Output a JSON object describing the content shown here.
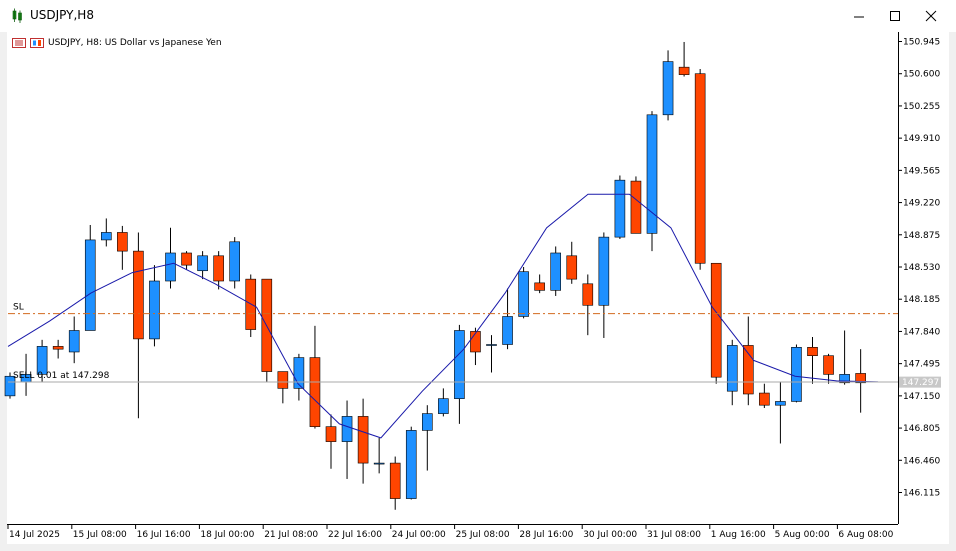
{
  "window": {
    "title": "USDJPY,H8"
  },
  "chart_header": {
    "text": "USDJPY, H8:  US Dollar vs Japanese Yen"
  },
  "colors": {
    "bull": "#1e90ff",
    "bear": "#ff4500",
    "ma": "#1a1aaa",
    "sl": "#d2691e"
  },
  "chart_data": {
    "type": "candlestick",
    "symbol": "USDJPY",
    "timeframe": "H8",
    "ylim": [
      145.815,
      151.12
    ],
    "y_ticks": [
      "150.945",
      "150.600",
      "150.255",
      "149.910",
      "149.565",
      "149.220",
      "148.875",
      "148.530",
      "148.185",
      "147.840",
      "147.495",
      "147.150",
      "146.805",
      "146.460",
      "146.115"
    ],
    "x_tick_labels": [
      "14 Jul 2025",
      "15 Jul 08:00",
      "16 Jul 16:00",
      "18 Jul 00:00",
      "21 Jul 08:00",
      "22 Jul 16:00",
      "24 Jul 00:00",
      "25 Jul 08:00",
      "28 Jul 16:00",
      "30 Jul 00:00",
      "31 Jul 08:00",
      "1 Aug 16:00",
      "5 Aug 00:00",
      "6 Aug 08:00"
    ],
    "current_price": "147.297",
    "sl_label": "SL",
    "sl_level": 148.03,
    "position_label": "SELL 0.01 at 147.298",
    "position_level": 147.298,
    "candles": [
      {
        "o": 147.15,
        "h": 147.4,
        "l": 147.12,
        "c": 147.36
      },
      {
        "o": 147.3,
        "h": 147.6,
        "l": 147.15,
        "c": 147.38
      },
      {
        "o": 147.38,
        "h": 147.75,
        "l": 147.3,
        "c": 147.68
      },
      {
        "o": 147.68,
        "h": 147.75,
        "l": 147.55,
        "c": 147.65
      },
      {
        "o": 147.62,
        "h": 148.0,
        "l": 147.5,
        "c": 147.85
      },
      {
        "o": 147.85,
        "h": 148.98,
        "l": 147.85,
        "c": 148.82
      },
      {
        "o": 148.82,
        "h": 149.05,
        "l": 148.75,
        "c": 148.9
      },
      {
        "o": 148.9,
        "h": 148.97,
        "l": 148.5,
        "c": 148.7
      },
      {
        "o": 148.7,
        "h": 148.9,
        "l": 146.91,
        "c": 147.76
      },
      {
        "o": 147.76,
        "h": 148.55,
        "l": 147.68,
        "c": 148.38
      },
      {
        "o": 148.38,
        "h": 148.95,
        "l": 148.3,
        "c": 148.68
      },
      {
        "o": 148.68,
        "h": 148.7,
        "l": 148.5,
        "c": 148.55
      },
      {
        "o": 148.49,
        "h": 148.7,
        "l": 148.4,
        "c": 148.65
      },
      {
        "o": 148.65,
        "h": 148.7,
        "l": 148.29,
        "c": 148.38
      },
      {
        "o": 148.38,
        "h": 148.85,
        "l": 148.3,
        "c": 148.8
      },
      {
        "o": 148.4,
        "h": 148.45,
        "l": 147.78,
        "c": 147.86
      },
      {
        "o": 148.4,
        "h": 148.4,
        "l": 147.3,
        "c": 147.41
      },
      {
        "o": 147.41,
        "h": 147.41,
        "l": 147.07,
        "c": 147.23
      },
      {
        "o": 147.23,
        "h": 147.6,
        "l": 147.1,
        "c": 147.56
      },
      {
        "o": 147.56,
        "h": 147.9,
        "l": 146.8,
        "c": 146.82
      },
      {
        "o": 146.82,
        "h": 146.95,
        "l": 146.37,
        "c": 146.66
      },
      {
        "o": 146.66,
        "h": 147.1,
        "l": 146.26,
        "c": 146.93
      },
      {
        "o": 146.93,
        "h": 147.12,
        "l": 146.21,
        "c": 146.43
      },
      {
        "o": 146.43,
        "h": 146.7,
        "l": 146.32,
        "c": 146.43
      },
      {
        "o": 146.43,
        "h": 146.5,
        "l": 145.93,
        "c": 146.05
      },
      {
        "o": 146.05,
        "h": 146.82,
        "l": 146.04,
        "c": 146.78
      },
      {
        "o": 146.78,
        "h": 147.05,
        "l": 146.35,
        "c": 146.96
      },
      {
        "o": 146.96,
        "h": 147.23,
        "l": 146.93,
        "c": 147.12
      },
      {
        "o": 147.12,
        "h": 147.91,
        "l": 146.85,
        "c": 147.85
      },
      {
        "o": 147.84,
        "h": 147.88,
        "l": 147.48,
        "c": 147.62
      },
      {
        "o": 147.7,
        "h": 147.8,
        "l": 147.4,
        "c": 147.7
      },
      {
        "o": 147.7,
        "h": 148.3,
        "l": 147.65,
        "c": 148.0
      },
      {
        "o": 148.0,
        "h": 148.53,
        "l": 147.98,
        "c": 148.48
      },
      {
        "o": 148.36,
        "h": 148.45,
        "l": 148.25,
        "c": 148.28
      },
      {
        "o": 148.28,
        "h": 148.75,
        "l": 148.22,
        "c": 148.68
      },
      {
        "o": 148.65,
        "h": 148.8,
        "l": 148.35,
        "c": 148.4
      },
      {
        "o": 148.35,
        "h": 148.45,
        "l": 147.8,
        "c": 148.12
      },
      {
        "o": 148.12,
        "h": 148.9,
        "l": 147.77,
        "c": 148.85
      },
      {
        "o": 148.85,
        "h": 149.51,
        "l": 148.83,
        "c": 149.46
      },
      {
        "o": 149.45,
        "h": 149.5,
        "l": 148.89,
        "c": 148.89
      },
      {
        "o": 148.89,
        "h": 150.2,
        "l": 148.7,
        "c": 150.16
      },
      {
        "o": 150.16,
        "h": 150.85,
        "l": 150.1,
        "c": 150.73
      },
      {
        "o": 150.67,
        "h": 150.94,
        "l": 150.57,
        "c": 150.59
      },
      {
        "o": 150.6,
        "h": 150.65,
        "l": 148.5,
        "c": 148.57
      },
      {
        "o": 148.57,
        "h": 148.57,
        "l": 147.28,
        "c": 147.35
      },
      {
        "o": 147.2,
        "h": 147.75,
        "l": 147.05,
        "c": 147.69
      },
      {
        "o": 147.69,
        "h": 148.0,
        "l": 147.05,
        "c": 147.17
      },
      {
        "o": 147.18,
        "h": 147.28,
        "l": 147.02,
        "c": 147.05
      },
      {
        "o": 147.05,
        "h": 147.3,
        "l": 146.64,
        "c": 147.09
      },
      {
        "o": 147.09,
        "h": 147.7,
        "l": 147.08,
        "c": 147.67
      },
      {
        "o": 147.67,
        "h": 147.78,
        "l": 147.28,
        "c": 147.58
      },
      {
        "o": 147.58,
        "h": 147.6,
        "l": 147.28,
        "c": 147.38
      },
      {
        "o": 147.29,
        "h": 147.85,
        "l": 147.27,
        "c": 147.38
      },
      {
        "o": 147.39,
        "h": 147.65,
        "l": 146.97,
        "c": 147.29
      }
    ],
    "ma": [
      147.68,
      147.95,
      148.25,
      148.47,
      148.57,
      148.35,
      148.1,
      147.28,
      146.85,
      146.7,
      147.2,
      147.65,
      148.25,
      148.95,
      149.31,
      149.31,
      148.95,
      148.1,
      147.53,
      147.36,
      147.31,
      147.3
    ]
  }
}
